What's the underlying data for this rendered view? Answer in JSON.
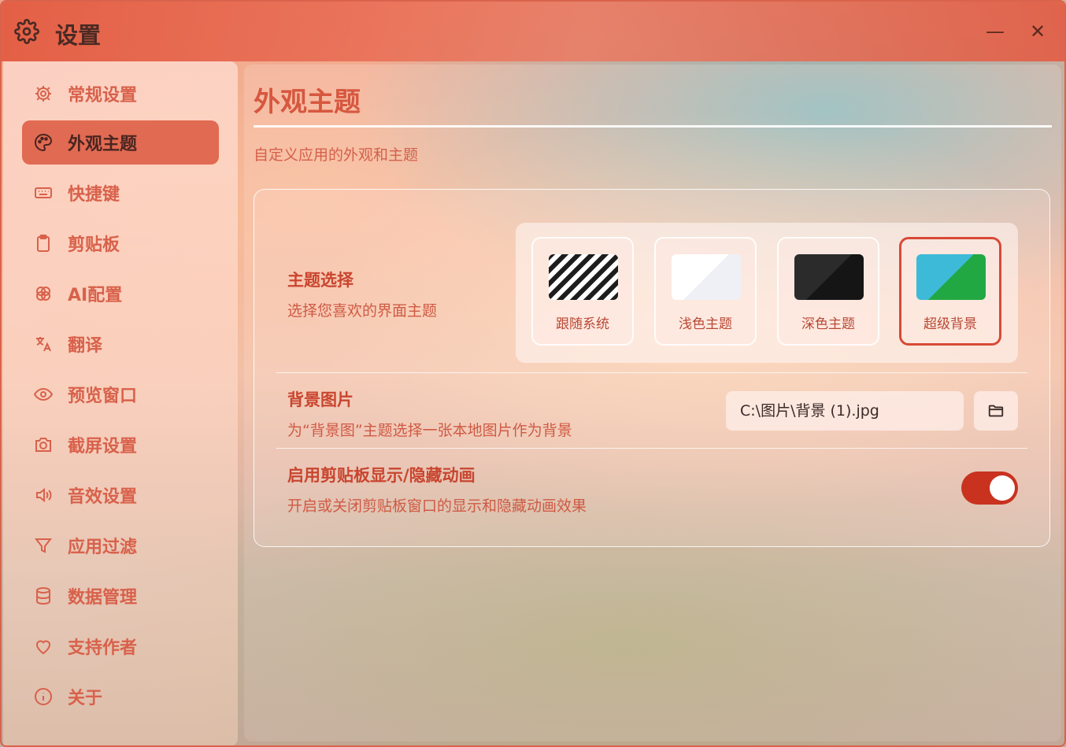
{
  "window": {
    "title": "设置",
    "icons": {
      "app": "gear-icon",
      "minimize": "minimize-icon",
      "close": "close-icon"
    },
    "minimize_symbol": "—",
    "close_symbol": "✕"
  },
  "sidebar": {
    "active_index": 1,
    "items": [
      {
        "label": "常规设置",
        "icon": "gear-icon"
      },
      {
        "label": "外观主题",
        "icon": "palette-icon"
      },
      {
        "label": "快捷键",
        "icon": "keyboard-icon"
      },
      {
        "label": "剪贴板",
        "icon": "clipboard-icon"
      },
      {
        "label": "AI配置",
        "icon": "ai-knot-icon"
      },
      {
        "label": "翻译",
        "icon": "translate-icon"
      },
      {
        "label": "预览窗口",
        "icon": "eye-icon"
      },
      {
        "label": "截屏设置",
        "icon": "camera-icon"
      },
      {
        "label": "音效设置",
        "icon": "speaker-icon"
      },
      {
        "label": "应用过滤",
        "icon": "filter-icon"
      },
      {
        "label": "数据管理",
        "icon": "database-icon"
      },
      {
        "label": "支持作者",
        "icon": "heart-icon"
      },
      {
        "label": "关于",
        "icon": "info-icon"
      }
    ]
  },
  "main": {
    "title": "外观主题",
    "description": "自定义应用的外观和主题",
    "theme": {
      "title": "主题选择",
      "description": "选择您喜欢的界面主题",
      "selected": "超级背景",
      "options": [
        {
          "label": "跟随系统",
          "swatch": "stripes"
        },
        {
          "label": "浅色主题",
          "swatch": "light"
        },
        {
          "label": "深色主题",
          "swatch": "dark"
        },
        {
          "label": "超级背景",
          "swatch": "cyan-green"
        }
      ]
    },
    "background": {
      "title": "背景图片",
      "description": "为“背景图”主题选择一张本地图片作为背景",
      "path_value": "C:\\图片\\背景 (1).jpg",
      "browse_icon": "folder-icon"
    },
    "animation": {
      "title": "启用剪贴板显示/隐藏动画",
      "description": "开启或关闭剪贴板窗口的显示和隐藏动画效果",
      "enabled": true
    }
  },
  "colors": {
    "accent": "#d84a36",
    "toggle_on": "#c8321f",
    "title_bar": "#e25a40",
    "text_accent": "#d6573f"
  }
}
